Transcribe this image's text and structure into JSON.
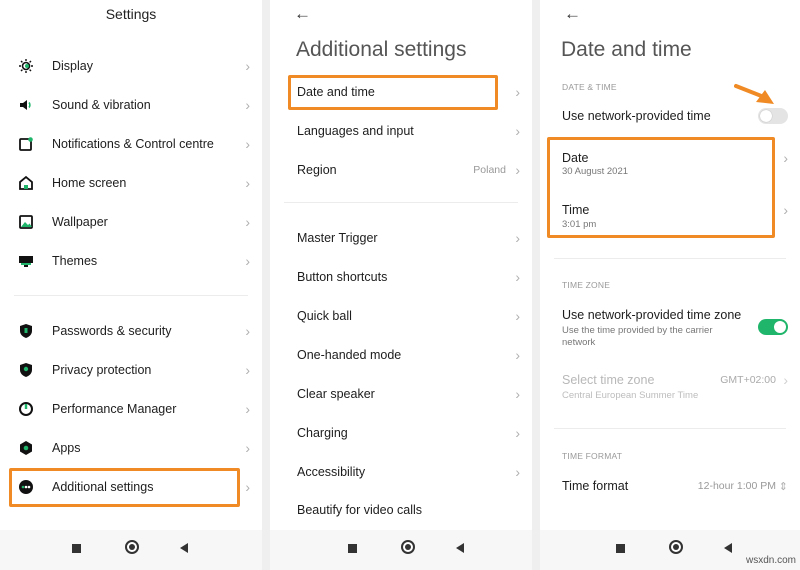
{
  "settings": {
    "title": "Settings",
    "items": [
      {
        "label": "Display",
        "icon": "display-icon"
      },
      {
        "label": "Sound & vibration",
        "icon": "sound-icon"
      },
      {
        "label": "Notifications & Control centre",
        "icon": "notifications-icon"
      },
      {
        "label": "Home screen",
        "icon": "home-icon"
      },
      {
        "label": "Wallpaper",
        "icon": "wallpaper-icon"
      },
      {
        "label": "Themes",
        "icon": "themes-icon"
      },
      {
        "label": "Passwords & security",
        "icon": "shield-icon"
      },
      {
        "label": "Privacy protection",
        "icon": "privacy-icon"
      },
      {
        "label": "Performance Manager",
        "icon": "performance-icon"
      },
      {
        "label": "Apps",
        "icon": "apps-icon"
      },
      {
        "label": "Additional settings",
        "icon": "additional-settings-icon"
      }
    ]
  },
  "additional": {
    "title": "Additional settings",
    "items": [
      {
        "label": "Date and time"
      },
      {
        "label": "Languages and input"
      },
      {
        "label": "Region",
        "value": "Poland"
      },
      {
        "label": "Master Trigger"
      },
      {
        "label": "Button shortcuts"
      },
      {
        "label": "Quick ball"
      },
      {
        "label": "One-handed mode"
      },
      {
        "label": "Clear speaker"
      },
      {
        "label": "Charging"
      },
      {
        "label": "Accessibility"
      },
      {
        "label": "Beautify for video calls"
      }
    ]
  },
  "datetime": {
    "title": "Date and time",
    "section_date_time": "DATE & TIME",
    "network_time_label": "Use network-provided time",
    "network_time_on": false,
    "date_label": "Date",
    "date_value": "30 August 2021",
    "time_label": "Time",
    "time_value": "3:01 pm",
    "section_time_zone": "TIME ZONE",
    "network_tz_label": "Use network-provided time zone",
    "network_tz_sub": "Use the time provided by the carrier network",
    "network_tz_on": true,
    "select_tz_label": "Select time zone",
    "select_tz_sub": "Central European Summer Time",
    "select_tz_value": "GMT+02:00",
    "section_time_format": "TIME FORMAT",
    "time_format_label": "Time format",
    "time_format_value": "12-hour 1:00 PM"
  },
  "colors": {
    "highlight": "#f08a24",
    "toggle_on": "#1fb56a",
    "icon_green": "#1fb56a"
  },
  "watermark": "wsxdn.com"
}
